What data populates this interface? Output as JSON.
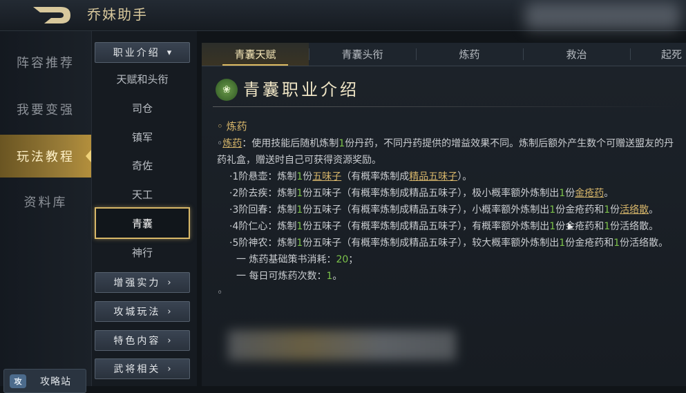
{
  "app": {
    "title": "乔妹助手"
  },
  "left_nav": [
    {
      "label": "阵容推荐",
      "active": false
    },
    {
      "label": "我要变强",
      "active": false
    },
    {
      "label": "玩法教程",
      "active": true
    },
    {
      "label": "资料库",
      "active": false
    }
  ],
  "guide_button": {
    "label": "攻略站",
    "icon": "chat-bubble-icon",
    "icon_text": "攻"
  },
  "categories": {
    "top": {
      "label": "职业介绍",
      "icon": "chevron-down-icon"
    },
    "sub_items": [
      {
        "label": "天赋和头衔",
        "active": false
      },
      {
        "label": "司仓",
        "active": false
      },
      {
        "label": "镇军",
        "active": false
      },
      {
        "label": "奇佐",
        "active": false
      },
      {
        "label": "天工",
        "active": false
      },
      {
        "label": "青囊",
        "active": true
      },
      {
        "label": "神行",
        "active": false
      }
    ],
    "bottom": [
      {
        "label": "增强实力"
      },
      {
        "label": "攻城玩法"
      },
      {
        "label": "特色内容"
      },
      {
        "label": "武将相关"
      }
    ],
    "chevron_right": "›"
  },
  "tabs": [
    {
      "label": "青囊天赋",
      "active": true
    },
    {
      "label": "青囊头衔",
      "active": false
    },
    {
      "label": "炼药",
      "active": false
    },
    {
      "label": "救治",
      "active": false
    },
    {
      "label": "起死",
      "active": false
    }
  ],
  "content": {
    "icon": "lotus-icon",
    "title": "青囊职业介绍",
    "section": "炼药",
    "intro_link": "炼药",
    "intro_a": "：使用技能后随机炼制",
    "intro_num": "1",
    "intro_b": "份丹药，不同丹药提供的增益效果不同。炼制后额外产生数个可赠送盟友的丹药礼盒，赠送时自己可获得资源奖励。",
    "levels": [
      {
        "a": "·1阶悬壶：炼制",
        "n1": "1",
        "b": "份",
        "link1": "五味子",
        "c": "（有概率炼制成",
        "link2": "精品五味子",
        "d": "）。",
        "n2": "",
        "e": "",
        "link3": "",
        "n3": "",
        "f": "",
        "link4": "",
        "g": ""
      },
      {
        "a": "·2阶去疾：炼制",
        "n1": "1",
        "b": "份五味子（有概率炼制成精品五味子），极小概率额外炼制出",
        "link1": "",
        "c": "",
        "link2": "",
        "d": "",
        "n2": "1",
        "e": "份",
        "link3": "金疮药",
        "n3": "",
        "f": "。",
        "link4": "",
        "g": ""
      },
      {
        "a": "·3阶回春：炼制",
        "n1": "1",
        "b": "份五味子（有概率炼制成精品五味子），小概率额外炼制出",
        "link1": "",
        "c": "",
        "link2": "",
        "d": "",
        "n2": "1",
        "e": "份金疮药和",
        "link3": "",
        "n3": "1",
        "f": "份",
        "link4": "活络散",
        "g": "。"
      },
      {
        "a": "·4阶仁心：炼制",
        "n1": "1",
        "b": "份五味子（有概率炼制成精品五味子），有概率额外炼制出",
        "link1": "",
        "c": "",
        "link2": "",
        "d": "",
        "n2": "1",
        "e": "份金疮药和",
        "link3": "",
        "n3": "1",
        "f": "份活络散。",
        "link4": "",
        "g": ""
      },
      {
        "a": "·5阶神农：炼制",
        "n1": "1",
        "b": "份五味子（有概率炼制成精品五味子），较大概率额外炼制出",
        "link1": "",
        "c": "",
        "link2": "",
        "d": "",
        "n2": "1",
        "e": "份金疮药和",
        "link3": "",
        "n3": "1",
        "f": "份活络散。",
        "link4": "",
        "g": ""
      }
    ],
    "stats": [
      {
        "label": "一 炼药基础策书消耗：",
        "value": "20",
        "suffix": "；"
      },
      {
        "label": "一 每日可炼药次数：",
        "value": "1",
        "suffix": "。"
      }
    ]
  },
  "colors": {
    "accent_gold": "#d6b56a",
    "highlight_green": "#7cc24a",
    "active_nav": "#9a7d38"
  }
}
